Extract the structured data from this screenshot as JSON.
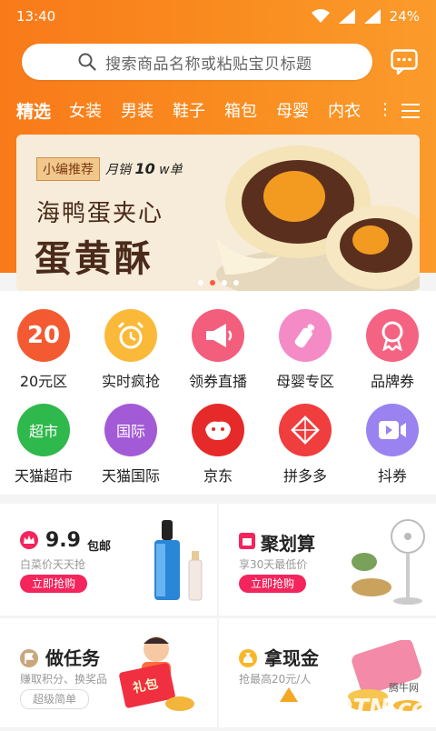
{
  "status_bar": {
    "time": "13:40",
    "battery": "24%"
  },
  "search": {
    "placeholder": "搜索商品名称或粘贴宝贝标题"
  },
  "tabs": [
    "精选",
    "女装",
    "男装",
    "鞋子",
    "箱包",
    "母婴",
    "内衣"
  ],
  "banner": {
    "tag": "小编推荐",
    "sales_prefix": "月销",
    "sales_number": "10",
    "sales_suffix": "w单",
    "title_line1": "海鸭蛋夹心",
    "title_line2": "蛋黄酥",
    "pages": 4,
    "active_page": 2
  },
  "categories": [
    {
      "label": "20元区",
      "badge": "20",
      "color": "#f45a32",
      "icon": "twenty-icon"
    },
    {
      "label": "实时疯抢",
      "color": "#fbb93a",
      "icon": "alarm-clock-icon"
    },
    {
      "label": "领券直播",
      "color": "#f35e7d",
      "icon": "megaphone-icon"
    },
    {
      "label": "母婴专区",
      "color": "#f48bc6",
      "icon": "baby-bottle-icon"
    },
    {
      "label": "品牌券",
      "color": "#f46482",
      "icon": "award-ribbon-icon"
    },
    {
      "label": "天猫超市",
      "badge": "超市",
      "color": "#2fb84c",
      "icon": "tmall-cat-icon"
    },
    {
      "label": "天猫国际",
      "badge": "国际",
      "color": "#a35ad7",
      "icon": "tmall-cat-icon"
    },
    {
      "label": "京东",
      "color": "#e62a2a",
      "icon": "jd-dog-icon"
    },
    {
      "label": "拼多多",
      "color": "#f03d3d",
      "icon": "pinduoduo-icon"
    },
    {
      "label": "抖券",
      "color": "#9a83f0",
      "icon": "video-play-icon"
    }
  ],
  "promos": [
    {
      "title": "9.9",
      "title_suffix": "包邮",
      "subtitle": "白菜价天天抢",
      "button": "立即抢购",
      "icon": "crown-icon"
    },
    {
      "title": "聚划算",
      "subtitle": "享30天最低价",
      "button": "立即抢购",
      "icon": "bag-icon"
    },
    {
      "title": "做任务",
      "subtitle": "赚取积分、换奖品",
      "button": "超级简单",
      "icon": "flag-icon",
      "badge": "礼包"
    },
    {
      "title": "拿现金",
      "subtitle": "抢最高20元/人",
      "button": "",
      "icon": "money-bag-icon"
    }
  ],
  "watermark": {
    "brand": "QQTN.com",
    "label": "腾牛网"
  },
  "colors": {
    "accent": "#f98b1f",
    "button_red": "#f4245c"
  }
}
